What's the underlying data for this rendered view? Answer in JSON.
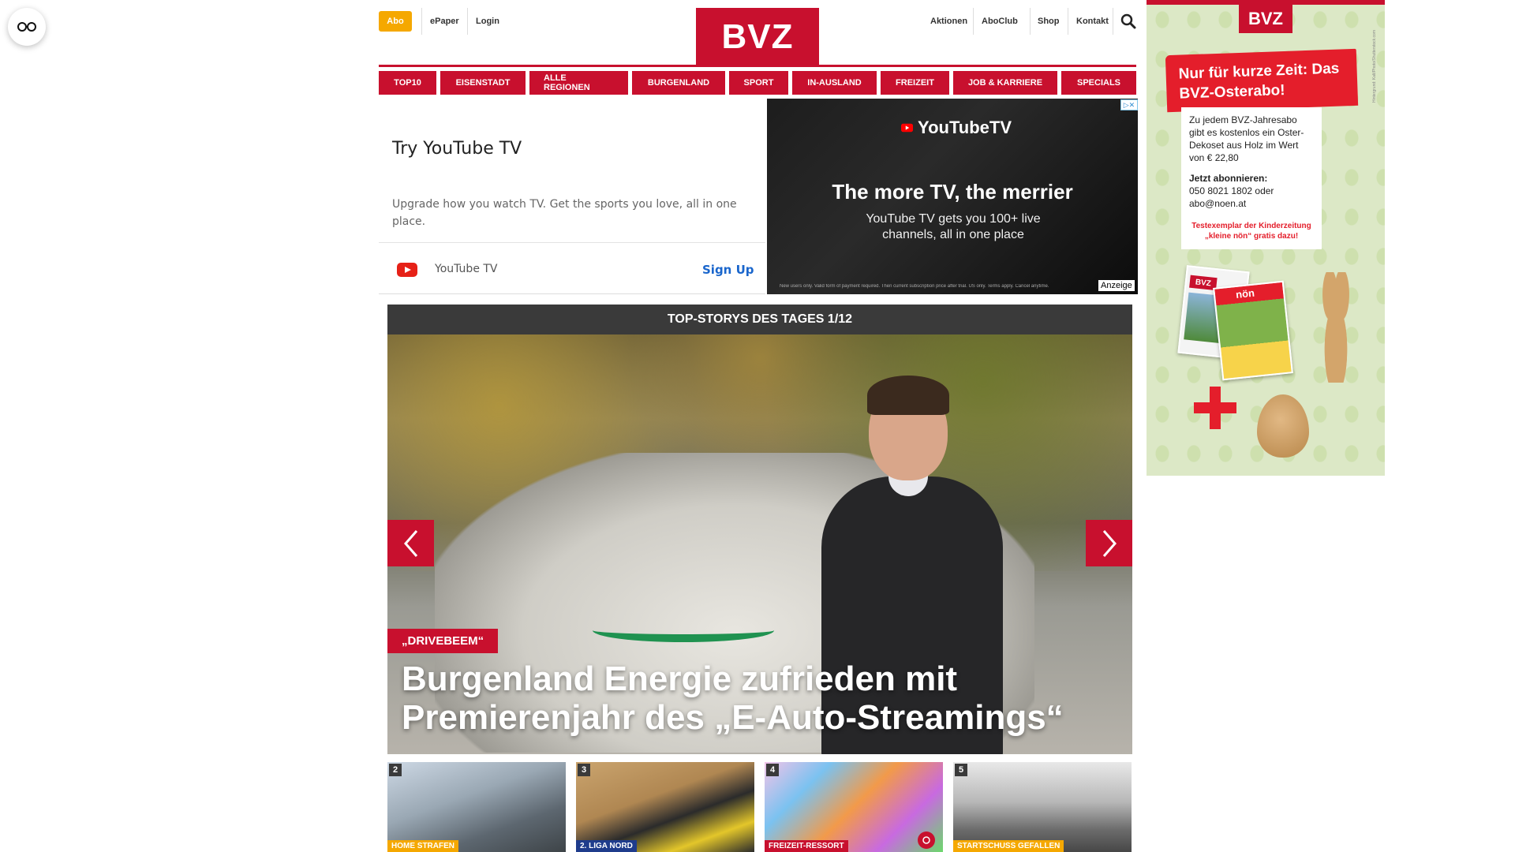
{
  "header": {
    "abo_label": "Abo",
    "epaper_label": "ePaper",
    "login_label": "Login",
    "logo_text": "BVZ",
    "right_links": [
      "Aktionen",
      "AboClub",
      "Shop",
      "Kontakt"
    ]
  },
  "nav": {
    "items": [
      "TOP10",
      "EISENSTADT",
      "ALLE REGIONEN",
      "BURGENLAND",
      "SPORT",
      "IN-AUSLAND",
      "FREIZEIT",
      "JOB & KARRIERE",
      "SPECIALS"
    ]
  },
  "ad_left": {
    "title": "Try YouTube TV",
    "description": "Upgrade how you watch TV. Get the sports you love, all in one place.",
    "brand": "YouTube TV",
    "cta": "Sign Up"
  },
  "ad_right": {
    "logo_text": "YouTubeTV",
    "headline": "The more TV, the merrier",
    "subline": "YouTube TV gets you 100+ live channels, all in one place",
    "fine_print": "New users only. Valid form of payment required. Then current subscription price after trial. US only. Terms apply. Cancel anytime.",
    "anzeige": "Anzeige"
  },
  "top_stories": {
    "header": "TOP-STORYS DES TAGES 1/12",
    "hero_tag": "„DRIVEBEEM“",
    "hero_title": "Burgenland Energie zufrieden mit Premierenjahr des „E-Auto-Streamings“",
    "thumbs": [
      {
        "num": "2",
        "tag": "HOME STRAFEN"
      },
      {
        "num": "3",
        "tag": "2. LIGA NORD"
      },
      {
        "num": "4",
        "tag": "FREIZEIT-RESSORT"
      },
      {
        "num": "5",
        "tag": "STARTSCHUSS GEFALLEN"
      }
    ]
  },
  "side_ad": {
    "logo_text": "BVZ",
    "banner": "Nur für kurze Zeit: Das BVZ-Osterabo!",
    "body": "Zu jedem BVZ-Jahresabo gibt es kostenlos ein Oster-Dekoset aus Holz im Wert von € 22,80",
    "subscribe_label": "Jetzt abonnieren:",
    "contact": "050 8021 1802 oder abo@noen.at",
    "kinder": "Testexemplar der Kinderzeitung „kleine nön“ gratis dazu!",
    "vertical_text": "Hintergrund: Kalt/Photo/Shutterstock.com",
    "mag_label": "nön"
  },
  "colors": {
    "brand_red": "#c8102e",
    "abo_orange": "#f5a800",
    "link_blue": "#1a66cc"
  }
}
